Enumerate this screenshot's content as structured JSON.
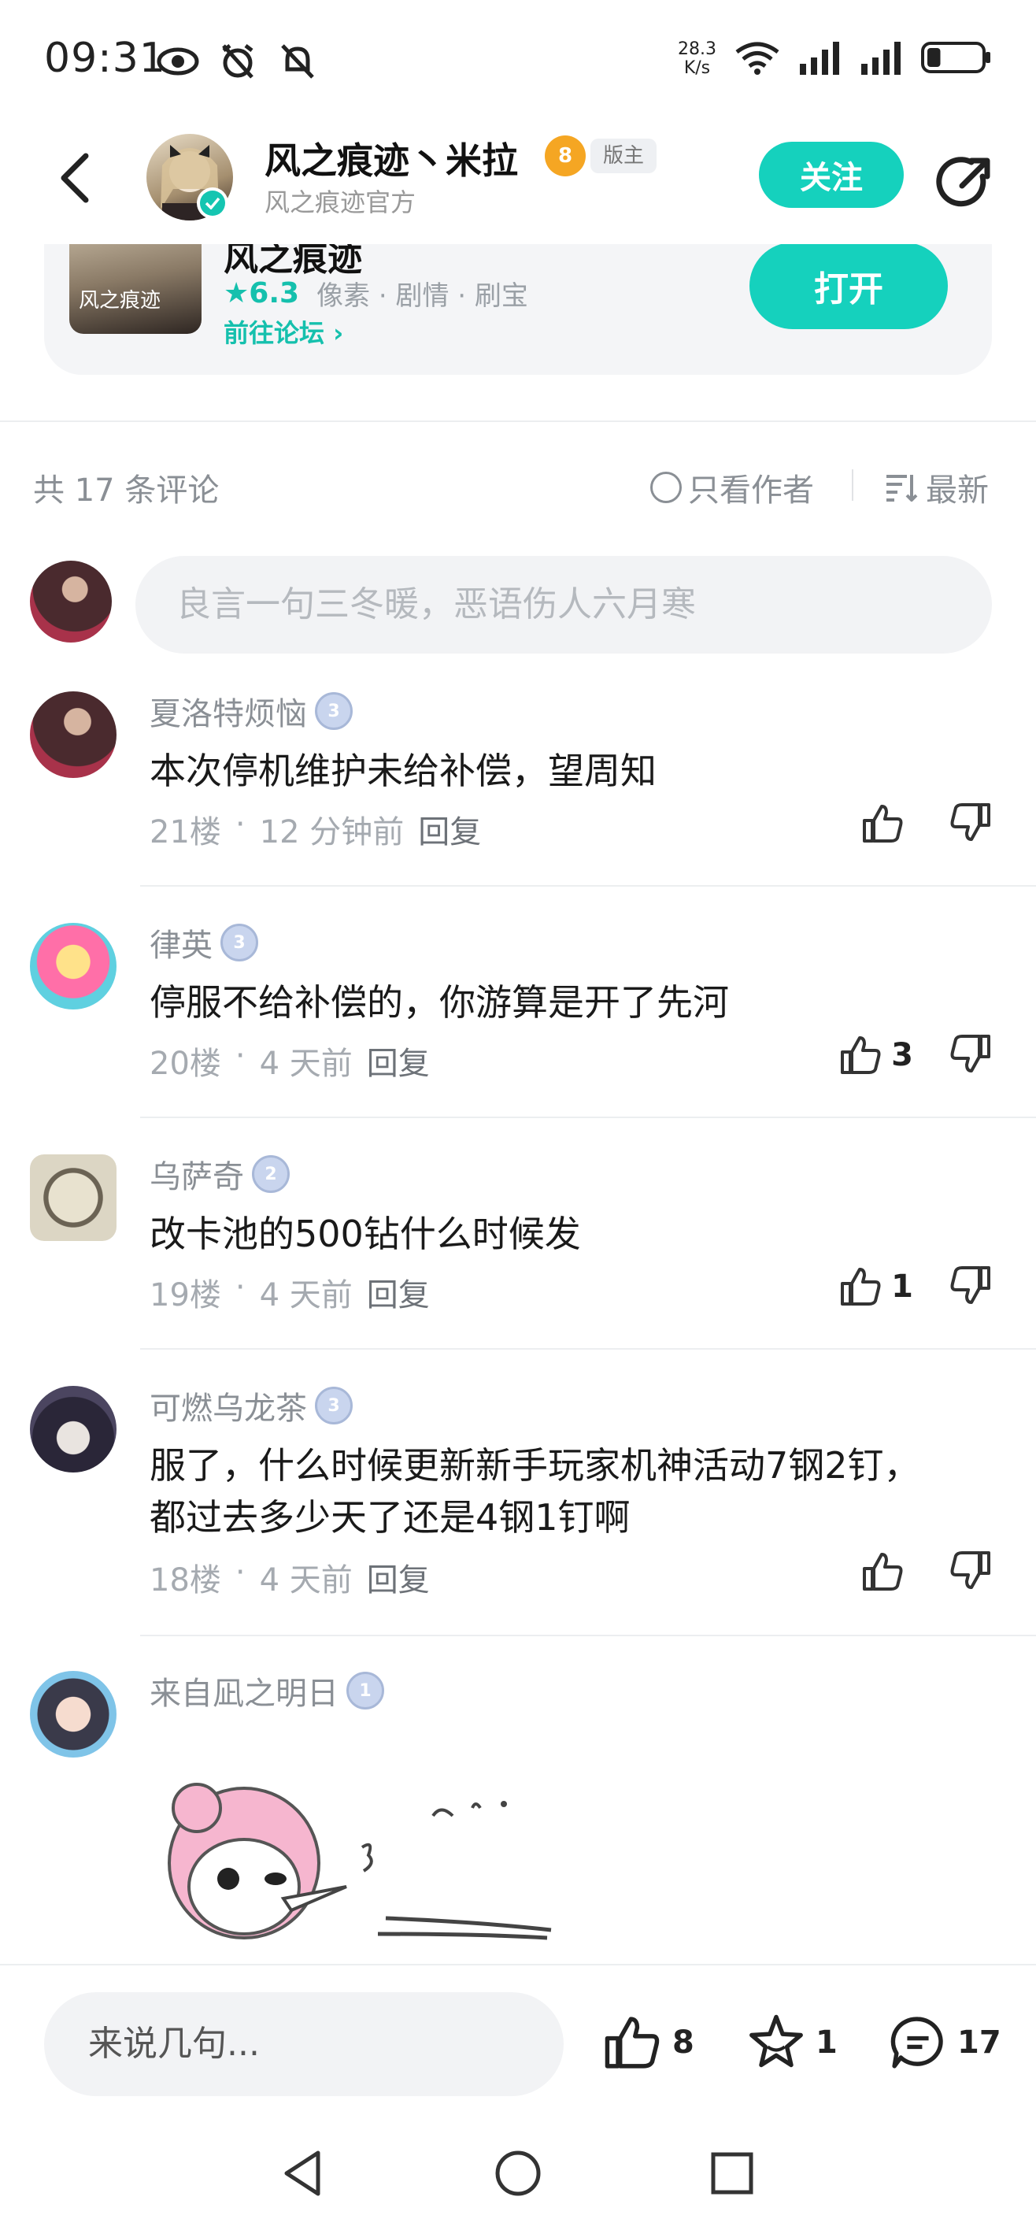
{
  "status_bar": {
    "time": "09:31",
    "net_speed_value": "28.3",
    "net_speed_unit": "K/s",
    "battery_level": 0.25
  },
  "header": {
    "name": "风之痕迹丶米拉",
    "level": "8",
    "role_badge": "版主",
    "subtitle": "风之痕迹官方",
    "follow_label": "关注"
  },
  "game_card": {
    "name": "风之痕迹",
    "thumb_text": "风之痕迹",
    "score": "★6.3",
    "tags": "像素 · 剧情 · 刷宝",
    "forum_link": "前往论坛 ›",
    "open_label": "打开"
  },
  "comments_header": {
    "count": "共 17 条评论",
    "author_only": "只看作者",
    "sort": "最新"
  },
  "input": {
    "placeholder": "良言一句三冬暖，恶语伤人六月寒"
  },
  "comments": [
    {
      "name": "夏洛特烦恼",
      "level": "3",
      "text": "本次停机维护未给补偿，望周知",
      "floor": "21楼",
      "time": "12 分钟前",
      "reply": "回复",
      "likes": ""
    },
    {
      "name": "律英",
      "level": "3",
      "text": "停服不给补偿的，你游算是开了先河",
      "floor": "20楼",
      "time": "4 天前",
      "reply": "回复",
      "likes": "3"
    },
    {
      "name": "乌萨奇",
      "level": "2",
      "text": "改卡池的500钻什么时候发",
      "floor": "19楼",
      "time": "4 天前",
      "reply": "回复",
      "likes": "1"
    },
    {
      "name": "可燃乌龙茶",
      "level": "3",
      "text_line1": "服了，什么时候更新新手玩家机神活动7钢2钉，",
      "text_line2": "都过去多少天了还是4钢1钉啊",
      "floor": "18楼",
      "time": "4 天前",
      "reply": "回复",
      "likes": ""
    },
    {
      "name": "来自凪之明日",
      "level": "1"
    }
  ],
  "bottom_bar": {
    "input_placeholder": "来说几句...",
    "likes": "8",
    "favorites": "1",
    "comments": "17"
  }
}
